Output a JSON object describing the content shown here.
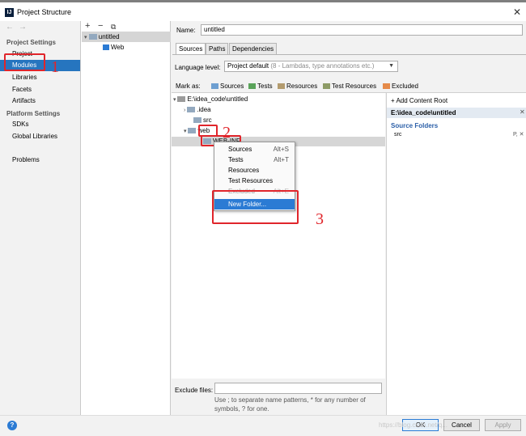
{
  "window": {
    "app_icon": "IJ",
    "title": "Project Structure",
    "close": "✕"
  },
  "nav": {
    "back": "←",
    "forward": "→"
  },
  "sidebar": {
    "project_settings": "Project Settings",
    "items_ps": [
      "Project",
      "Modules",
      "Libraries",
      "Facets",
      "Artifacts"
    ],
    "platform_settings": "Platform Settings",
    "items_pl": [
      "SDKs",
      "Global Libraries"
    ],
    "problems": "Problems",
    "selected": "Modules"
  },
  "modules_toolbar": {
    "add": "+",
    "remove": "−",
    "copy": "⧉"
  },
  "modules_tree": {
    "module": "untitled",
    "facet": "Web"
  },
  "name": {
    "label": "Name:",
    "value": "untitled"
  },
  "tabs": [
    "Sources",
    "Paths",
    "Dependencies"
  ],
  "language_level": {
    "label": "Language level:",
    "value": "Project default",
    "hint": "(8 - Lambdas, type annotations etc.)"
  },
  "mark_as": {
    "label": "Mark as:",
    "items": [
      "Sources",
      "Tests",
      "Resources",
      "Test Resources",
      "Excluded"
    ]
  },
  "mark_colors": {
    "Sources": "#6e9fd1",
    "Tests": "#5aa35a",
    "Resources": "#b39b6e",
    "Test Resources": "#8d9b66",
    "Excluded": "#e58a4a"
  },
  "file_tree": {
    "root": "E:\\idea_code\\untitled",
    "children": [
      ".idea",
      "src",
      "web"
    ],
    "web_child": "WEB-INF"
  },
  "context_menu": {
    "items": [
      {
        "label": "Sources",
        "shortcut": "Alt+S"
      },
      {
        "label": "Tests",
        "shortcut": "Alt+T"
      },
      {
        "label": "Resources",
        "shortcut": ""
      },
      {
        "label": "Test Resources",
        "shortcut": ""
      },
      {
        "label": "Excluded",
        "shortcut": "Alt+E"
      },
      {
        "label": "New Folder...",
        "shortcut": ""
      }
    ],
    "highlighted": "New Folder..."
  },
  "content_root": {
    "add": "+ Add Content Root",
    "path": "E:\\idea_code\\untitled",
    "source_folders": "Source Folders",
    "src": "src",
    "src_action": "P, ✕"
  },
  "annotations": [
    "1",
    "2",
    "3"
  ],
  "exclude": {
    "label": "Exclude files:",
    "value": "",
    "hint": "Use ; to separate name patterns, * for any number of symbols, ? for one."
  },
  "buttons": {
    "ok": "OK",
    "cancel": "Cancel",
    "apply": "Apply"
  },
  "help": "?",
  "watermark": "https://blog.csdn.net/q..."
}
